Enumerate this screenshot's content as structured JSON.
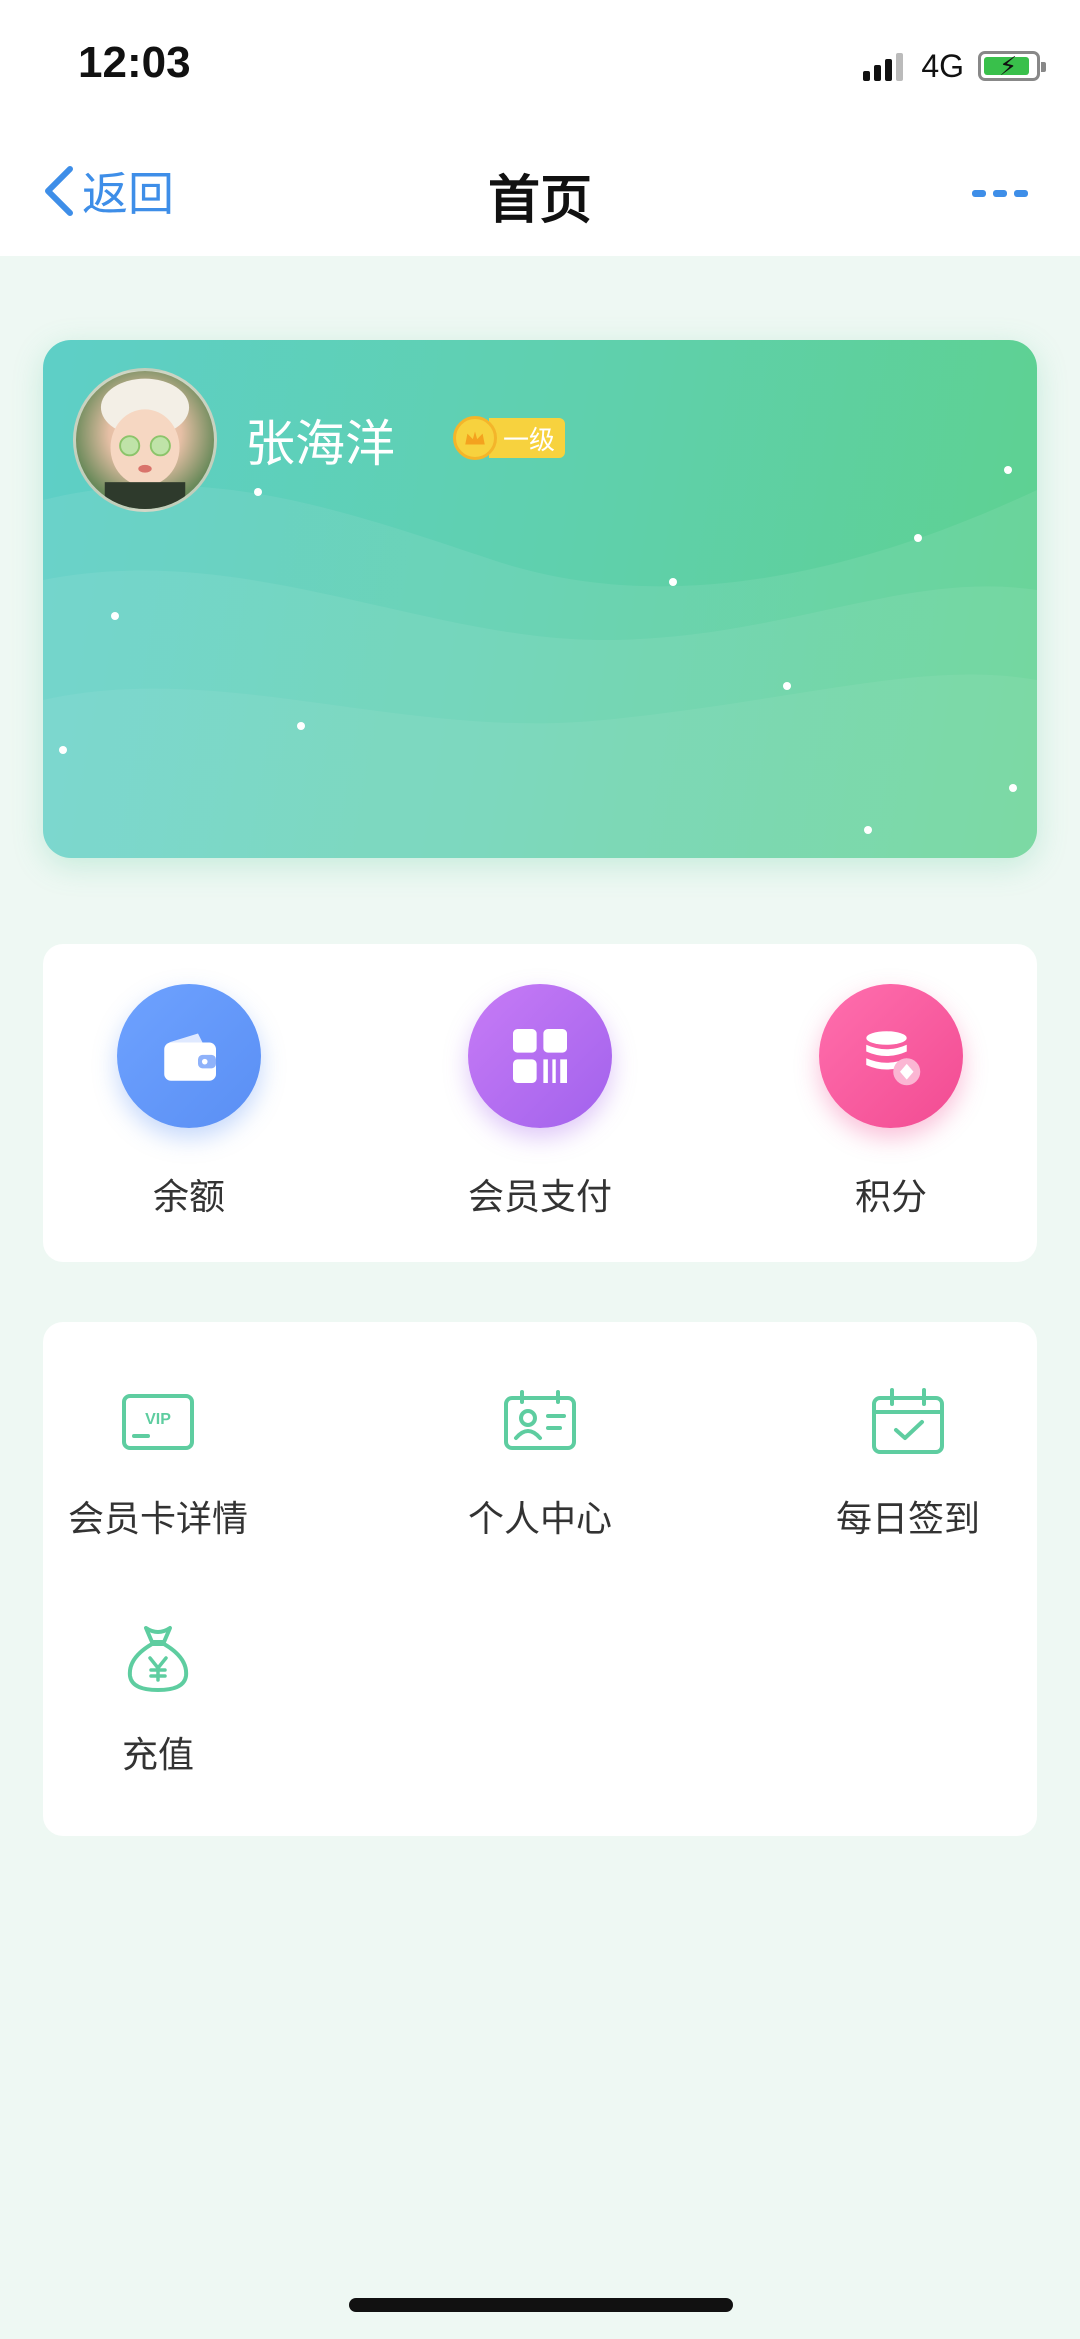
{
  "status": {
    "time": "12:03",
    "network": "4G",
    "battery_level": 0.9
  },
  "nav": {
    "back_label": "返回",
    "title": "首页"
  },
  "card": {
    "member_name": "张海洋",
    "level_label": "一级"
  },
  "quick_actions": [
    {
      "label": "余额",
      "icon": "wallet-icon",
      "color": "#6a9cf8"
    },
    {
      "label": "会员支付",
      "icon": "qr-pay-icon",
      "color": "#b46cf0"
    },
    {
      "label": "积分",
      "icon": "coins-icon",
      "color": "#f4609f"
    }
  ],
  "services": [
    {
      "label": "会员卡详情",
      "icon": "vip-card-icon"
    },
    {
      "label": "个人中心",
      "icon": "profile-card-icon"
    },
    {
      "label": "每日签到",
      "icon": "calendar-check-icon"
    },
    {
      "label": "充值",
      "icon": "money-bag-icon"
    }
  ],
  "colors": {
    "accent": "#3e8ee8",
    "service_icon": "#5ecda0",
    "card_gradient_start": "#5ecfc7",
    "card_gradient_end": "#5ed18f"
  }
}
